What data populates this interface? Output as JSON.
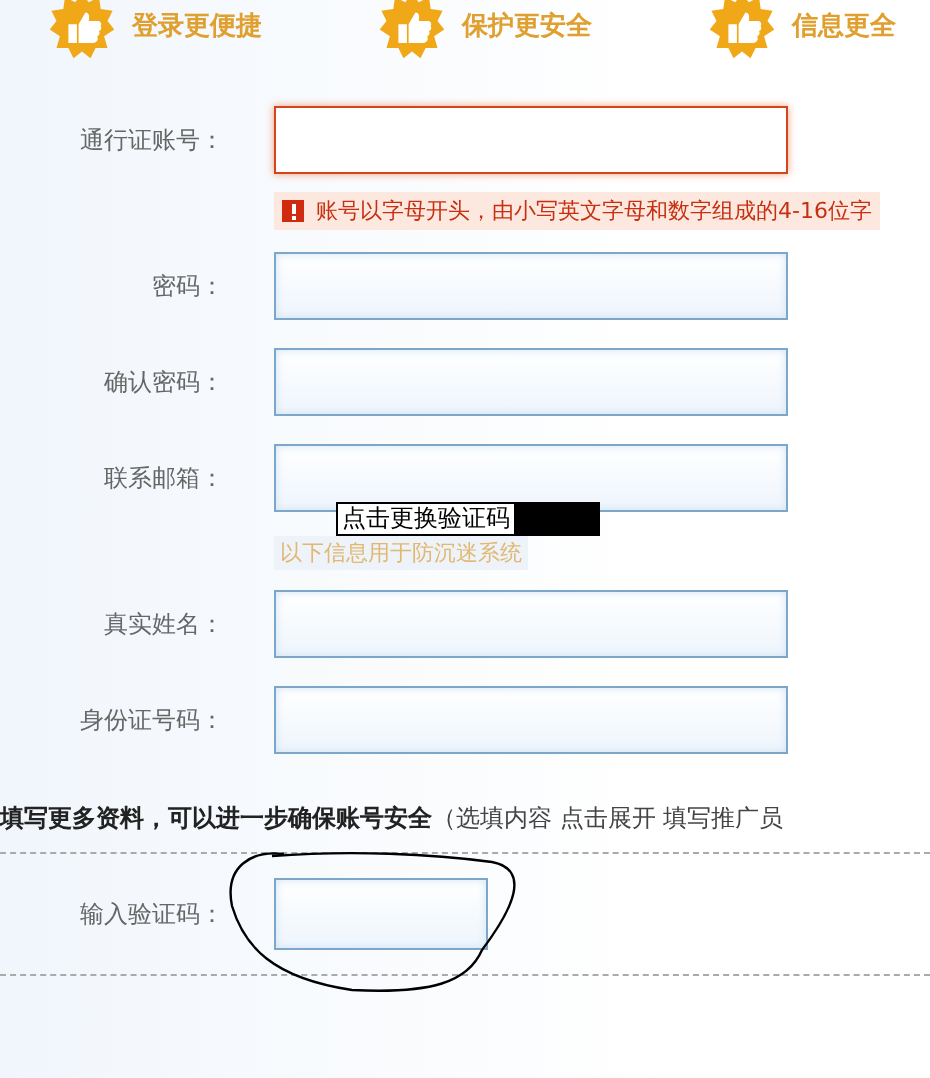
{
  "banner": [
    {
      "label": "登录更便捷"
    },
    {
      "label": "保护更安全"
    },
    {
      "label": "信息更全"
    }
  ],
  "fields": [
    {
      "label": "通行证账号：",
      "error": true,
      "message": {
        "kind": "error",
        "text": "账号以字母开头，由小写英文字母和数字组成的4-16位字"
      }
    },
    {
      "label": "密码：",
      "error": false
    },
    {
      "label": "确认密码：",
      "error": false
    },
    {
      "label": "联系邮箱：",
      "error": false,
      "message": {
        "kind": "hint",
        "text": "以下信息用于防沉迷系统"
      },
      "tooltip": "点击更换验证码"
    },
    {
      "label": "真实姓名：",
      "error": false
    },
    {
      "label": "身份证号码：",
      "error": false
    }
  ],
  "more_info": {
    "title": "填写更多资料，可以进一步确保账号安全",
    "note": "（选填内容 点击展开 填写推广员"
  },
  "captcha": {
    "label": "输入验证码：",
    "error": false
  }
}
